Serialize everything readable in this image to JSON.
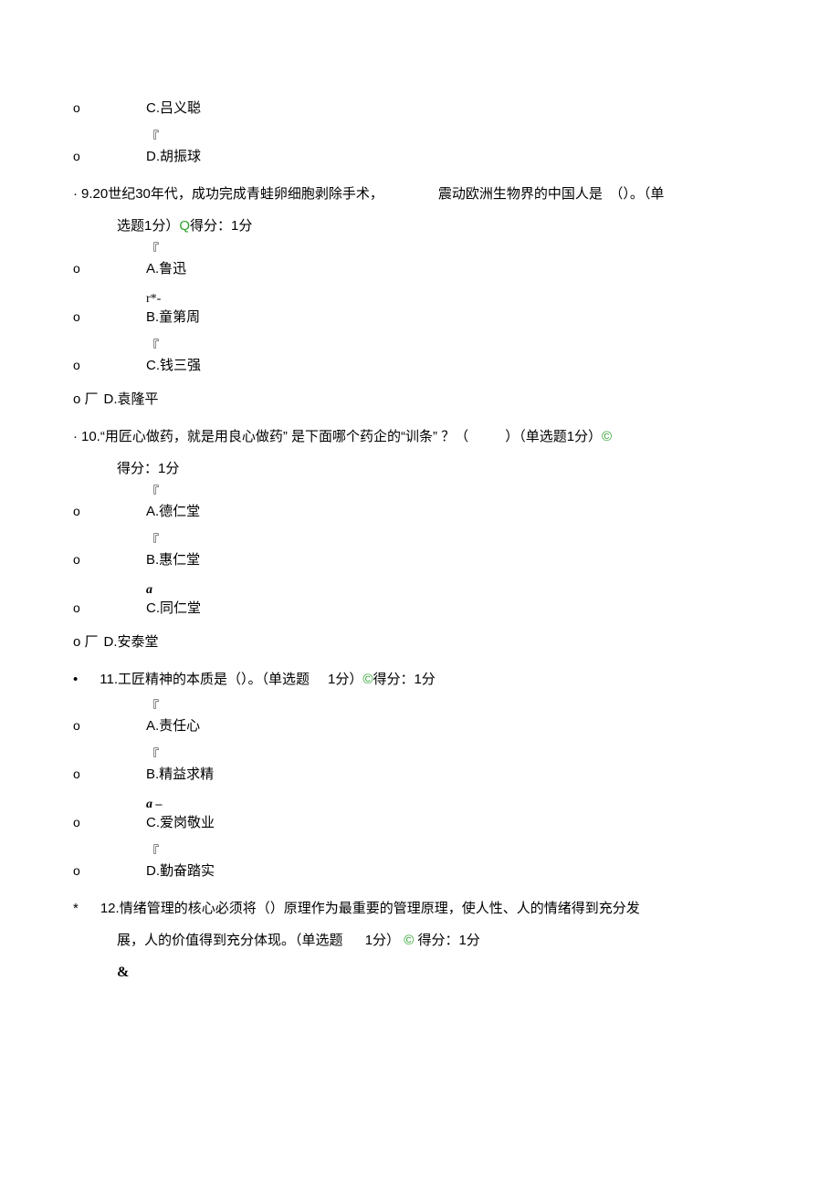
{
  "q8": {
    "options": {
      "c": {
        "bullet": "o",
        "mark": "",
        "label": "C.吕义聪"
      },
      "d": {
        "bullet": "o",
        "mark": "『",
        "label": "D.胡振球"
      }
    }
  },
  "q9": {
    "prefix": "·",
    "num": "9.",
    "text_left": "20世纪30年代，成功完成青蛙卵细胞剥除手术，",
    "text_right": "震动欧洲生物界的中国人是　（）。（单",
    "line2": "选题1分）",
    "q_mark": "Q",
    "score": "得分：1分",
    "options": {
      "a": {
        "bullet": "o",
        "mark": "『",
        "label": "A.鲁迅"
      },
      "b": {
        "bullet": "o",
        "mark": "r*-",
        "label": "B.童第周"
      },
      "c": {
        "bullet": "o",
        "mark": "『",
        "label": "C.钱三强"
      },
      "d": {
        "bullet": "o 厂",
        "mark": "",
        "label": "D.袁隆平"
      }
    }
  },
  "q10": {
    "prefix": "·",
    "num": "10.",
    "text_left": "“用匠心做药，就是用良心做药”  是下面哪个药企的“训条” ？（",
    "text_right": "）（单选题1分）",
    "c_mark": "©",
    "score": "得分：1分",
    "options": {
      "a": {
        "bullet": "o",
        "mark": "『",
        "label": "A.德仁堂"
      },
      "b": {
        "bullet": "o",
        "mark": "『",
        "label": "B.惠仁堂"
      },
      "c": {
        "bullet": "o",
        "mark": "a",
        "label": "C.同仁堂"
      },
      "d": {
        "bullet": "o 厂",
        "mark": "",
        "label": "D.安泰堂"
      }
    }
  },
  "q11": {
    "prefix": "•",
    "num": "11.",
    "text": "工匠精神的本质是（）。（单选题",
    "pts": "1分）",
    "c_mark": "©",
    "score": "得分：1分",
    "options": {
      "a": {
        "bullet": "o",
        "mark": "『",
        "label": "A.责任心"
      },
      "b": {
        "bullet": "o",
        "mark": "『",
        "label": "B.精益求精"
      },
      "c": {
        "bullet": "o",
        "mark": "a –",
        "label": "C.爱岗敬业"
      },
      "d": {
        "bullet": "o",
        "mark": "『",
        "label": "D.勤奋踏实"
      }
    }
  },
  "q12": {
    "prefix": "*",
    "num": "12.",
    "text1": "情绪管理的核心必须将（）原理作为最重要的管理原理，使人性、人的情绪得到充分发",
    "text2": "展，人的价值得到充分体现。（单选题",
    "pts": "1分）",
    "c_mark": "©",
    "score": "得分：1分",
    "amp": "&"
  }
}
